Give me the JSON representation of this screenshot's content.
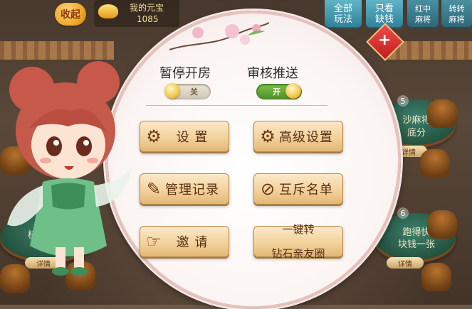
{
  "top_left": {
    "collapse_button": "收起",
    "coin_label": "我的元宝",
    "coin_value": "1085"
  },
  "top_tabs": [
    {
      "label": "全部\n玩法"
    },
    {
      "label": "只看\n缺钱"
    },
    {
      "label": "红中\n麻将"
    },
    {
      "label": "转转\n麻将"
    }
  ],
  "background_tables": {
    "left": {
      "text": "桂阳字牌",
      "detail": "详情"
    },
    "right_top": {
      "number": "5",
      "line1": "沙麻将",
      "line2": "底分",
      "detail": "详情"
    },
    "right_bottom": {
      "number": "6",
      "line1": "跑得快",
      "line2": "块钱一张",
      "detail": "详情"
    }
  },
  "dialog": {
    "pause_room": {
      "label": "暂停开房",
      "state_text": "关",
      "state": "off"
    },
    "review_push": {
      "label": "审核推送",
      "state_text": "开",
      "state": "on"
    },
    "buttons": {
      "settings": "设 置",
      "advanced_settings": "高级设置",
      "manage_records": "管理记录",
      "exclusion_list": "互斥名单",
      "invite": "邀 请",
      "convert_line1": "一键转",
      "convert_line2": "钻石亲友圈"
    }
  },
  "colors": {
    "button_text": "#5a2e12",
    "toggle_on": "#5ea836",
    "toggle_off": "#d8cfbf",
    "accent_red": "#d83232"
  },
  "icons": [
    "gear-icon",
    "gear-icon",
    "edit-record-icon",
    "block-user-icon",
    "invite-hand-icon",
    "kite-plus-icon",
    "coin-ingot-icon"
  ]
}
